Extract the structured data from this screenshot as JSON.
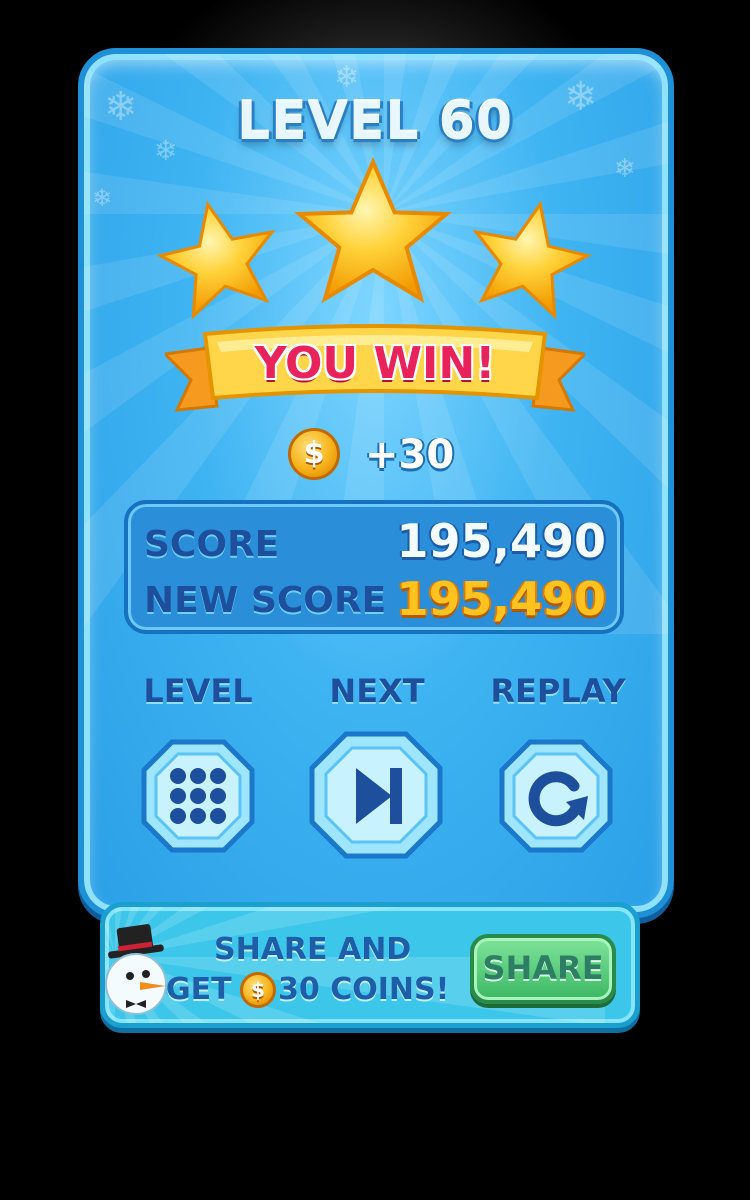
{
  "level_title": "LEVEL 60",
  "stars_earned": 3,
  "stars_total": 3,
  "banner_text": "YOU WIN!",
  "reward": {
    "coin_symbol": "$",
    "amount": "+30"
  },
  "scores": {
    "score_label": "SCORE",
    "score_value": "195,490",
    "new_score_label": "NEW SCORE",
    "new_score_value": "195,490"
  },
  "buttons": [
    {
      "label": "LEVEL",
      "icon": "grid-dots-icon"
    },
    {
      "label": "NEXT",
      "icon": "skip-next-icon"
    },
    {
      "label": "REPLAY",
      "icon": "replay-icon"
    }
  ],
  "share": {
    "line1": "SHARE AND",
    "line2_prefix": "GET",
    "coin_symbol": "$",
    "line2_suffix": "30 COINS!",
    "button_label": "SHARE",
    "mascot_icon": "snowman-icon"
  },
  "colors": {
    "panel_blue": "#3fb4f2",
    "star_gold": "#ffc21f",
    "banner_pink": "#e8235b",
    "label_navy": "#1d4f9c",
    "share_green": "#3cb864"
  }
}
